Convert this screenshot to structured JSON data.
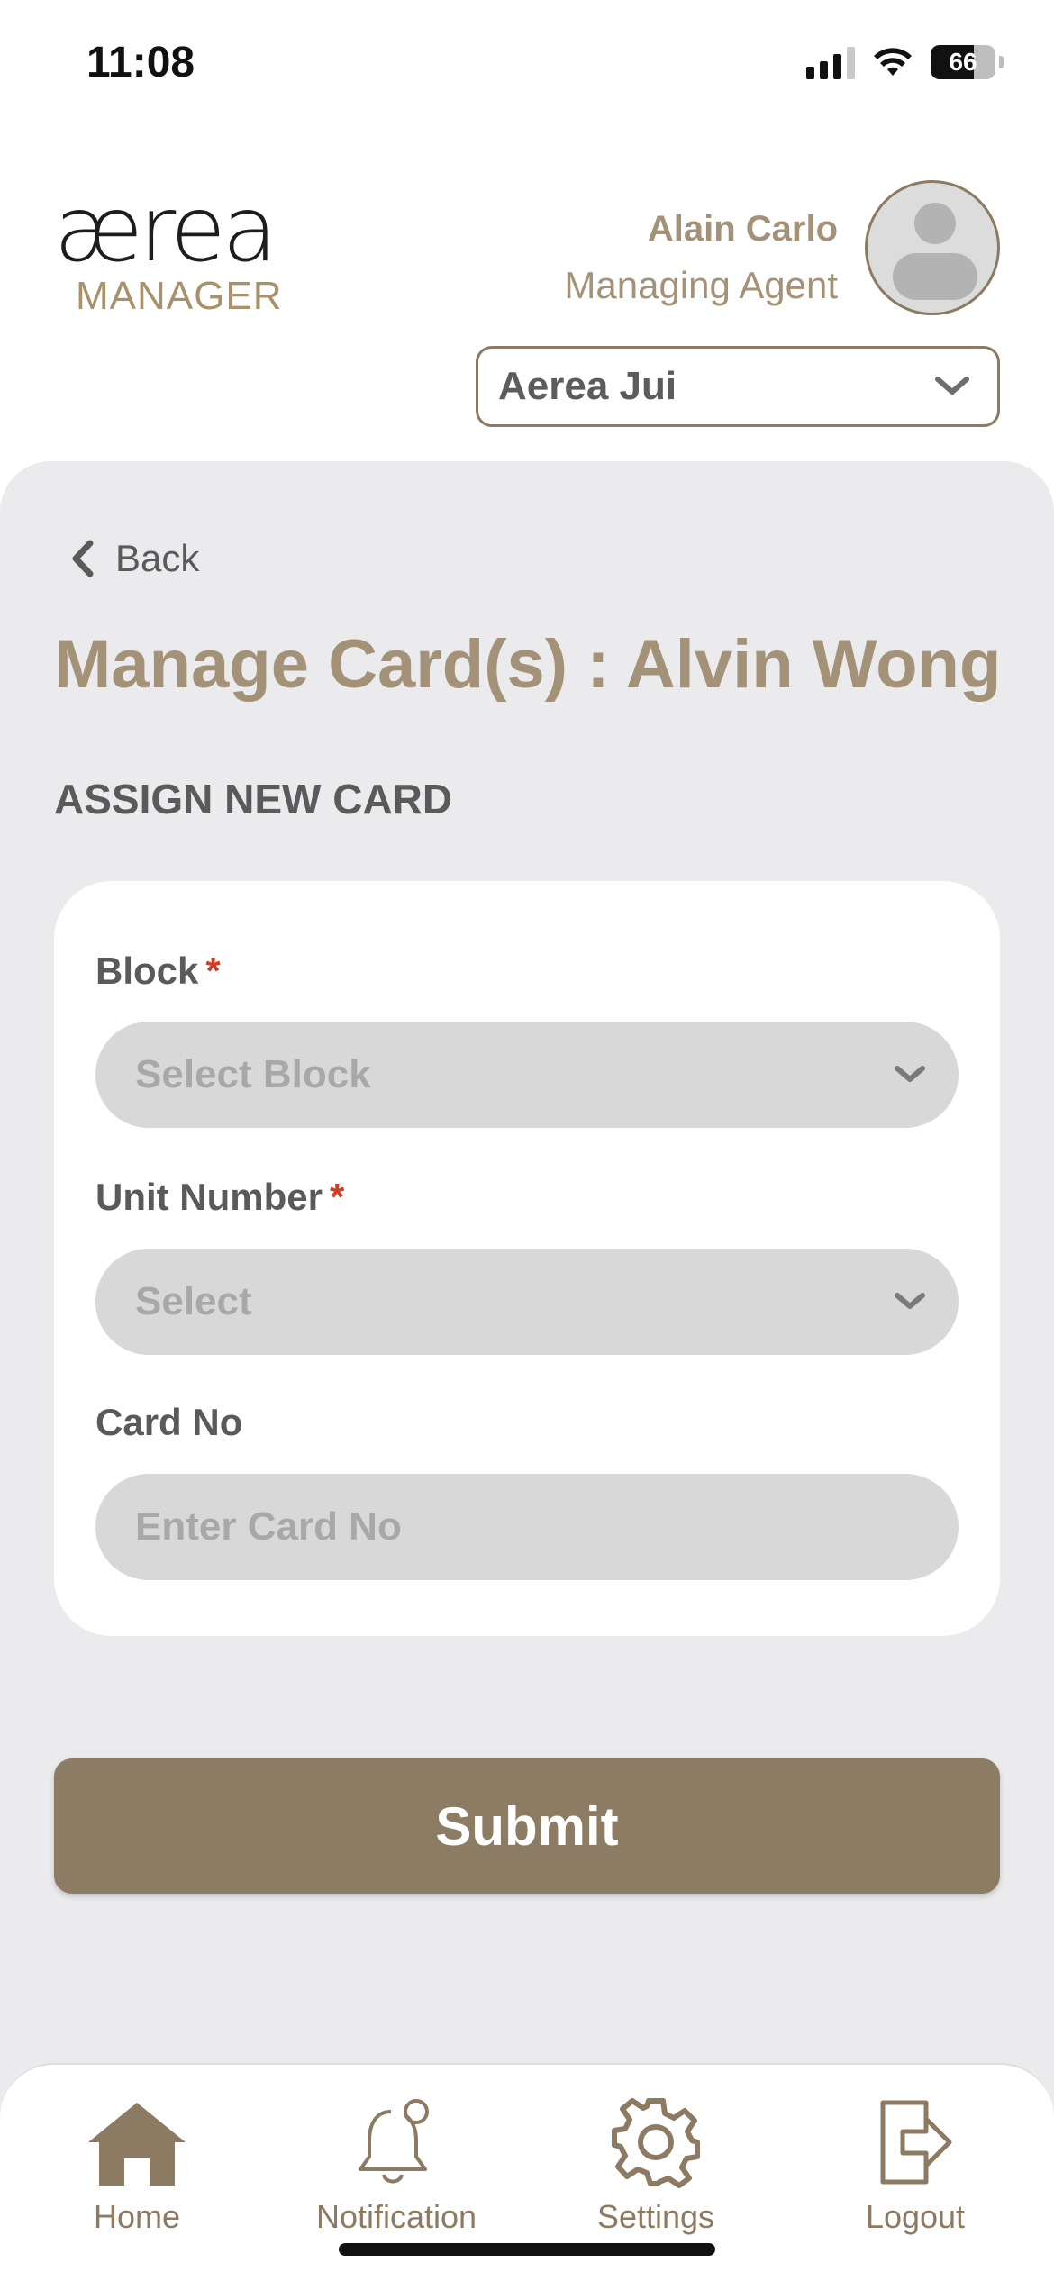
{
  "status_bar": {
    "time": "11:08",
    "battery": "66"
  },
  "header": {
    "logo_word": "ærea",
    "logo_sub": "MANAGER",
    "user_name": "Alain Carlo",
    "user_role": "Managing Agent",
    "property": "Aerea Jui"
  },
  "page": {
    "back_label": "Back",
    "title": "Manage Card(s) : Alvin Wong",
    "section_title": "ASSIGN NEW CARD"
  },
  "form": {
    "block": {
      "label": "Block",
      "required_mark": "*",
      "placeholder": "Select Block"
    },
    "unit": {
      "label": "Unit Number",
      "required_mark": "*",
      "placeholder": "Select"
    },
    "card": {
      "label": "Card No",
      "placeholder": "Enter Card No"
    },
    "submit_label": "Submit"
  },
  "nav": {
    "home": "Home",
    "notification": "Notification",
    "settings": "Settings",
    "logout": "Logout"
  },
  "colors": {
    "accent": "#8c7c64",
    "title": "#a39278",
    "panel_bg": "#ebebed",
    "field_bg": "#d8d8d8",
    "required": "#d23a24"
  },
  "icons": [
    "signal-icon",
    "wifi-icon",
    "battery-icon",
    "avatar-icon",
    "chevron-down-icon",
    "chevron-left-icon",
    "home-icon",
    "bell-icon",
    "gear-icon",
    "logout-icon"
  ]
}
